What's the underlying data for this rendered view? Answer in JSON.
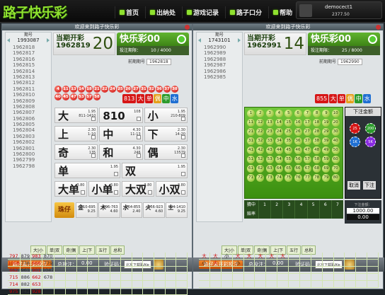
{
  "app": {
    "logo": "路子快乐彩"
  },
  "nav": [
    {
      "label": "首页"
    },
    {
      "label": "出纳处"
    },
    {
      "label": "游戏记录"
    },
    {
      "label": "路子口分"
    },
    {
      "label": "帮助"
    }
  ],
  "user": {
    "name": "democect1",
    "balance": "2377.50"
  },
  "panel1": {
    "header": "欢迎来到路子快乐彩",
    "history_label": "期号",
    "history_head": "1993087",
    "history": [
      "1962818",
      "1962817",
      "1962816",
      "1962815",
      "1962814",
      "1962813",
      "1962812",
      "1962811",
      "1962810",
      "1962809",
      "1962808",
      "1962807",
      "1962806",
      "1962805",
      "1962804",
      "1962803",
      "1962802",
      "1962801",
      "1962800",
      "1962799",
      "1962798"
    ],
    "current_label": "当期开彩",
    "current_issue": "1962819",
    "current_value": "20",
    "lottery": "快乐彩00",
    "bet_deadline_label": "投注期限：",
    "bet_deadline": "10 / 4000",
    "prev_label": "前期期号",
    "prev_issue": "1962818",
    "balls": [
      "4",
      "11",
      "13",
      "14",
      "18",
      "21",
      "22",
      "24",
      "25",
      "26",
      "27",
      "31",
      "32",
      "36",
      "37",
      "38",
      "40",
      "45",
      "47",
      "53",
      "57",
      "58"
    ],
    "sum": "813",
    "tags": [
      "大",
      "单",
      "偶",
      "中",
      "水"
    ],
    "markets": [
      [
        {
          "big": "大",
          "odd": "1.95\n811-1410"
        },
        {
          "big": "810",
          "odd": "108"
        },
        {
          "big": "小",
          "odd": "1.95\n210-809"
        }
      ],
      [
        {
          "big": "上",
          "odd": "2.30\n1-10"
        },
        {
          "big": "中",
          "odd": "4.30\n11-13"
        },
        {
          "big": "下",
          "odd": "2.30\n14-20"
        }
      ],
      [
        {
          "big": "奇",
          "odd": "2.30\n135"
        },
        {
          "big": "和",
          "odd": "4.30\n246"
        },
        {
          "big": "偶",
          "odd": "2.30\n13579"
        }
      ],
      [
        {
          "big": "单",
          "odd": "1.95"
        },
        {
          "big": "双",
          "odd": "1.95"
        }
      ],
      [
        {
          "big": "大单",
          "odd": "3.80"
        },
        {
          "big": "小单",
          "odd": "3.80"
        },
        {
          "big": "大双",
          "odd": "3.80"
        },
        {
          "big": "小双",
          "odd": "3.80"
        }
      ]
    ],
    "dice_label": "珠仔",
    "stats": [
      {
        "k": "金",
        "v": "210-695\n9.25"
      },
      {
        "k": "木",
        "v": "696-763\n4.60"
      },
      {
        "k": "水",
        "v": "764-855\n2.40"
      },
      {
        "k": "火",
        "v": "856-923\n4.60"
      },
      {
        "k": "土",
        "v": "924-1410\n9.25"
      }
    ],
    "bet_button": "路仔未开彩投注",
    "total_label": "总投注：",
    "total": "0.00",
    "vcode_label": "验证码：",
    "vcode": "北京下载路Ale",
    "tabs": [
      "大|小",
      "单|双",
      "奇|偶",
      "上|下",
      "五行",
      "总和"
    ],
    "trend": [
      [
        "797",
        "879",
        "983",
        "870"
      ],
      [
        "1008",
        "738",
        "666",
        "779"
      ],
      [
        "662",
        "961",
        "901",
        "1047"
      ],
      [
        "715",
        "886",
        "662",
        "678"
      ],
      [
        "714",
        "882",
        "653",
        ""
      ],
      [
        "975",
        "742",
        "928",
        ""
      ]
    ]
  },
  "panel2": {
    "header": "欢迎来到路子快乐彩",
    "history_label": "期号",
    "history_head": "1743101",
    "history": [
      "1962990",
      "1962989",
      "1962988",
      "1962987",
      "1962986",
      "1962985"
    ],
    "current_label": "当期开彩",
    "current_issue": "1962991",
    "current_value": "14",
    "lottery": "快乐彩00",
    "bet_deadline_label": "投注期限：",
    "bet_deadline": "25 / 8000",
    "prev_label": "前期期号",
    "prev_issue": "1962990",
    "sum": "855",
    "tags": [
      "大",
      "单",
      "偶",
      "中",
      "水"
    ],
    "numbers_rows": 8,
    "chips": [
      "25",
      "200",
      "1K",
      "5K"
    ],
    "side_title": "下注金额",
    "side_cancel": "取消",
    "side_confirm": "下注",
    "side_stake_label": "下注金额：",
    "side_stake": "1000.00",
    "side_total": "0.00",
    "odds_left": "猜中",
    "odds_right": "赔率",
    "odds_numbers": [
      "1",
      "2",
      "3",
      "4",
      "5",
      "6",
      "7"
    ],
    "bet_button": "路仔未开彩投注",
    "total_label": "总投注：",
    "total": "0.00",
    "vcode_label": "验证码：",
    "vcode": "北京下载路Ale",
    "tabs": [
      "大|小",
      "单|双",
      "奇|偶",
      "上|下",
      "五行",
      "总和"
    ],
    "trend_a": [
      "大",
      "大",
      "小",
      "大",
      "大",
      "大",
      "大",
      "大"
    ],
    "trend_b": [
      "小",
      "大",
      "",
      "小"
    ]
  }
}
